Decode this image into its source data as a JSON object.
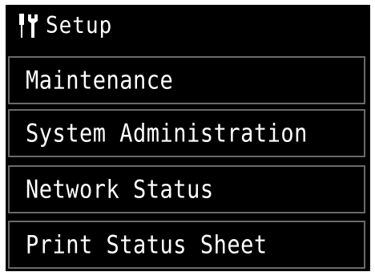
{
  "header": {
    "title": "Setup",
    "icon": "wrench-screwdriver-icon"
  },
  "menu": {
    "items": [
      {
        "label": "Maintenance"
      },
      {
        "label": "System Administration"
      },
      {
        "label": "Network Status"
      },
      {
        "label": "Print Status Sheet"
      }
    ]
  },
  "colors": {
    "background": "#000000",
    "text": "#ffffff",
    "item_border": "#6a6a6a"
  }
}
